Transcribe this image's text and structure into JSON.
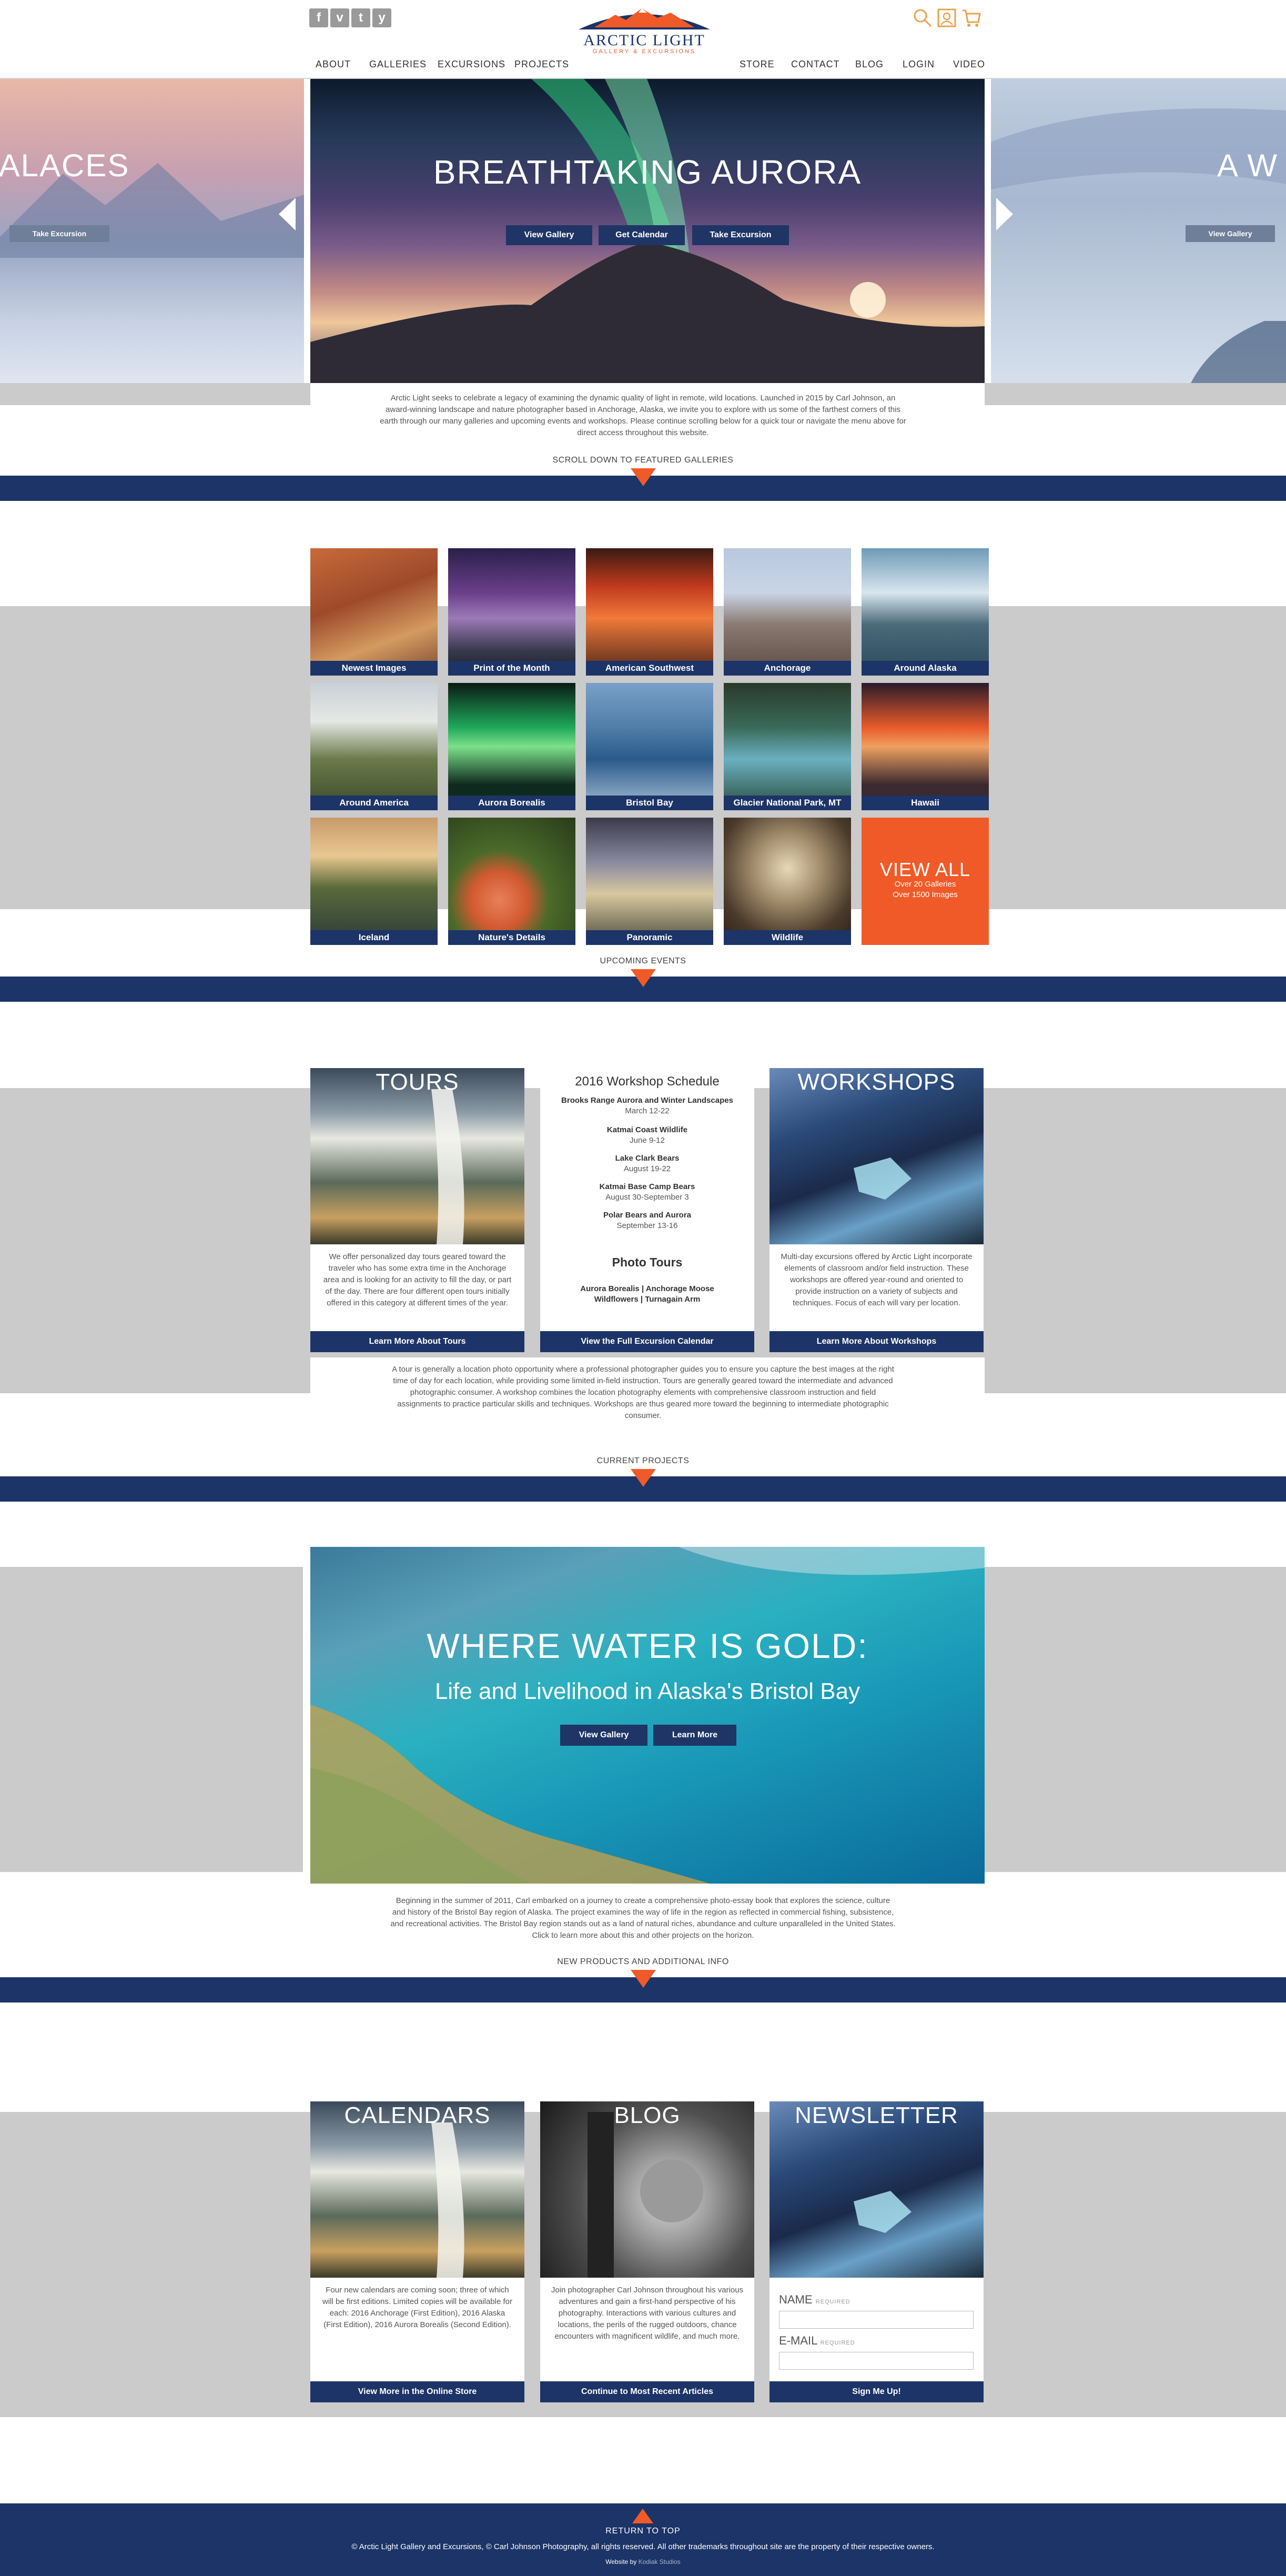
{
  "header": {
    "logo_title": "ARCTIC LIGHT",
    "logo_subtitle": "GALLERY & EXCURSIONS",
    "social": [
      "f",
      "v",
      "t",
      "y"
    ],
    "nav_left": [
      "ABOUT",
      "GALLERIES",
      "EXCURSIONS",
      "PROJECTS"
    ],
    "nav_right": [
      "STORE",
      "CONTACT",
      "BLOG",
      "LOGIN",
      "VIDEO"
    ],
    "icons": [
      "search-icon",
      "contact-card-icon",
      "cart-icon"
    ]
  },
  "hero": {
    "left_title": "PALACES",
    "left_button": "Take Excursion",
    "main_title": "BREATHTAKING AURORA",
    "buttons": [
      "View Gallery",
      "Get Calendar",
      "Take Excursion"
    ],
    "right_title": "A W",
    "right_button": "View Gallery"
  },
  "intro": {
    "text": "Arctic Light seeks to celebrate a legacy of examining the dynamic quality of light in remote, wild locations. Launched in 2015 by Carl Johnson, an award-winning landscape and nature photographer based in Anchorage, Alaska, we invite you to explore with us some of the farthest corners of this earth through our many galleries and upcoming events and workshops. Please continue scrolling below for a quick tour or navigate the menu above for direct access throughout this website.",
    "scroll_label": "SCROLL DOWN TO FEATURED GALLERIES"
  },
  "galleries": {
    "tiles": [
      "Newest Images",
      "Print of the Month",
      "American Southwest",
      "Anchorage",
      "Around Alaska",
      "Around America",
      "Aurora Borealis",
      "Bristol Bay",
      "Glacier National Park, MT",
      "Hawaii",
      "Iceland",
      "Nature's Details",
      "Panoramic",
      "Wildlife"
    ],
    "view_all": "VIEW ALL",
    "view_all_line1": "Over 20 Galleries",
    "view_all_line2": "Over 1500 Images",
    "next_label": "UPCOMING EVENTS"
  },
  "events": {
    "tours_title": "TOURS",
    "tours_text": "We offer personalized day tours geared toward the traveler who has some extra time in the Anchorage area and is looking for an activity to fill the day, or part of the day. There are four different open tours initially offered in this category at different times of the year.",
    "tours_button": "Learn More About Tours",
    "schedule_title": "2016 Workshop Schedule",
    "schedule": [
      {
        "name": "Brooks Range Aurora and Winter Landscapes",
        "date": "March 12-22"
      },
      {
        "name": "Katmai Coast Wildlife",
        "date": "June 9-12"
      },
      {
        "name": "Lake Clark Bears",
        "date": "August 19-22"
      },
      {
        "name": "Katmai Base Camp Bears",
        "date": "August 30-September 3"
      },
      {
        "name": "Polar Bears and Aurora",
        "date": "September 13-16"
      }
    ],
    "photo_tours_title": "Photo Tours",
    "photo_tours_line1": "Aurora Borealis | Anchorage Moose",
    "photo_tours_line2": "Wildflowers | Turnagain Arm",
    "calendar_button": "View the Full Excursion Calendar",
    "workshops_title": "WORKSHOPS",
    "workshops_text": "Multi-day excursions offered by Arctic Light incorporate elements of classroom and/or field instruction. These workshops are offered year-round and oriented to provide instruction on a variety of subjects and techniques. Focus of each will vary per location.",
    "workshops_button": "Learn More About Workshops",
    "summary": "A tour is generally a location photo opportunity where a professional photographer guides you to ensure you capture the best images at the right time of day for each location, while providing some limited in-field instruction. Tours are generally geared toward the intermediate and advanced photographic consumer. A workshop combines the location photography elements with comprehensive classroom instruction and field assignments to practice particular skills and techniques. Workshops are thus geared more toward the beginning to intermediate photographic consumer.",
    "next_label": "CURRENT PROJECTS"
  },
  "project": {
    "title": "WHERE WATER IS GOLD:",
    "subtitle": "Life and Livelihood in Alaska's Bristol Bay",
    "buttons": [
      "View Gallery",
      "Learn More"
    ],
    "text": "Beginning in the summer of 2011, Carl embarked on a journey to create a comprehensive photo-essay book that explores the science, culture and history of the Bristol Bay region of Alaska. The project examines the way of life in the region as reflected in commercial fishing, subsistence, and recreational activities. The Bristol Bay region stands out as a land of natural riches, abundance and culture unparalleled in the United States. Click to learn more about this and other projects on the horizon.",
    "next_label": "NEW PRODUCTS AND ADDITIONAL INFO"
  },
  "products": {
    "calendars_title": "CALENDARS",
    "calendars_text": "Four new calendars are coming soon; three of which will be first editions. Limited copies will be available for each: 2016 Anchorage (First Edition), 2016 Alaska (First Edition), 2016 Aurora Borealis (Second Edition).",
    "calendars_button": "View More in the Online Store",
    "blog_title": "BLOG",
    "blog_text": "Join photographer Carl Johnson throughout his various adventures and gain a first-hand perspective of his photography. Interactions with various cultures and locations, the perils of the rugged outdoors, chance encounters with magnificent wildlife, and much more.",
    "blog_button": "Continue to Most Recent Articles",
    "newsletter_title": "NEWSLETTER",
    "name_label": "NAME",
    "email_label": "E-MAIL",
    "required": "REQUIRED",
    "signup_button": "Sign Me Up!"
  },
  "footer": {
    "return_top": "RETURN TO TOP",
    "copyright": "© Arctic Light Gallery and Excursions, © Carl Johnson Photography, all rights reserved. All other trademarks throughout site are the property of their respective owners.",
    "website_by_label": "Website by",
    "website_by_value": "Kodiak Studios"
  },
  "colors": {
    "navy": "#1c3467",
    "orange": "#f05a28",
    "grey_band": "#cbcbcb"
  }
}
